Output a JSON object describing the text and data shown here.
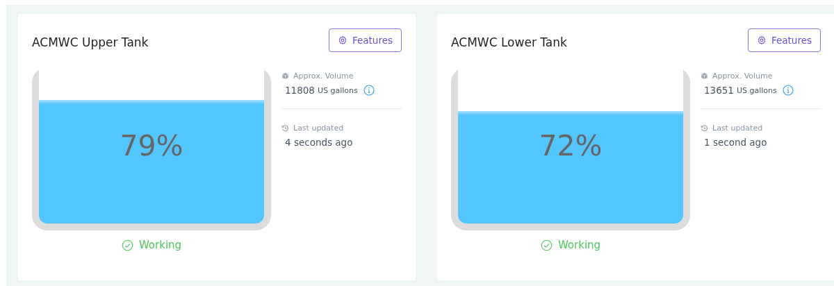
{
  "tanks": [
    {
      "title": "ACMWC Upper Tank",
      "button": "Features",
      "percent": "79%",
      "volume_label": "Approx. Volume",
      "volume": "11808",
      "unit": "US gallons",
      "updated_label": "Last updated",
      "updated": "4 seconds ago",
      "status": {
        "label": "Working",
        "ok": true
      }
    },
    {
      "title": "ACMWC Lower Tank",
      "button": "Features",
      "percent": "72%",
      "volume_label": "Approx. Volume",
      "volume": "13651",
      "unit": "US gallons",
      "updated_label": "Last updated",
      "updated": "1 second ago",
      "status": {
        "label": "Working",
        "ok": true
      }
    }
  ]
}
